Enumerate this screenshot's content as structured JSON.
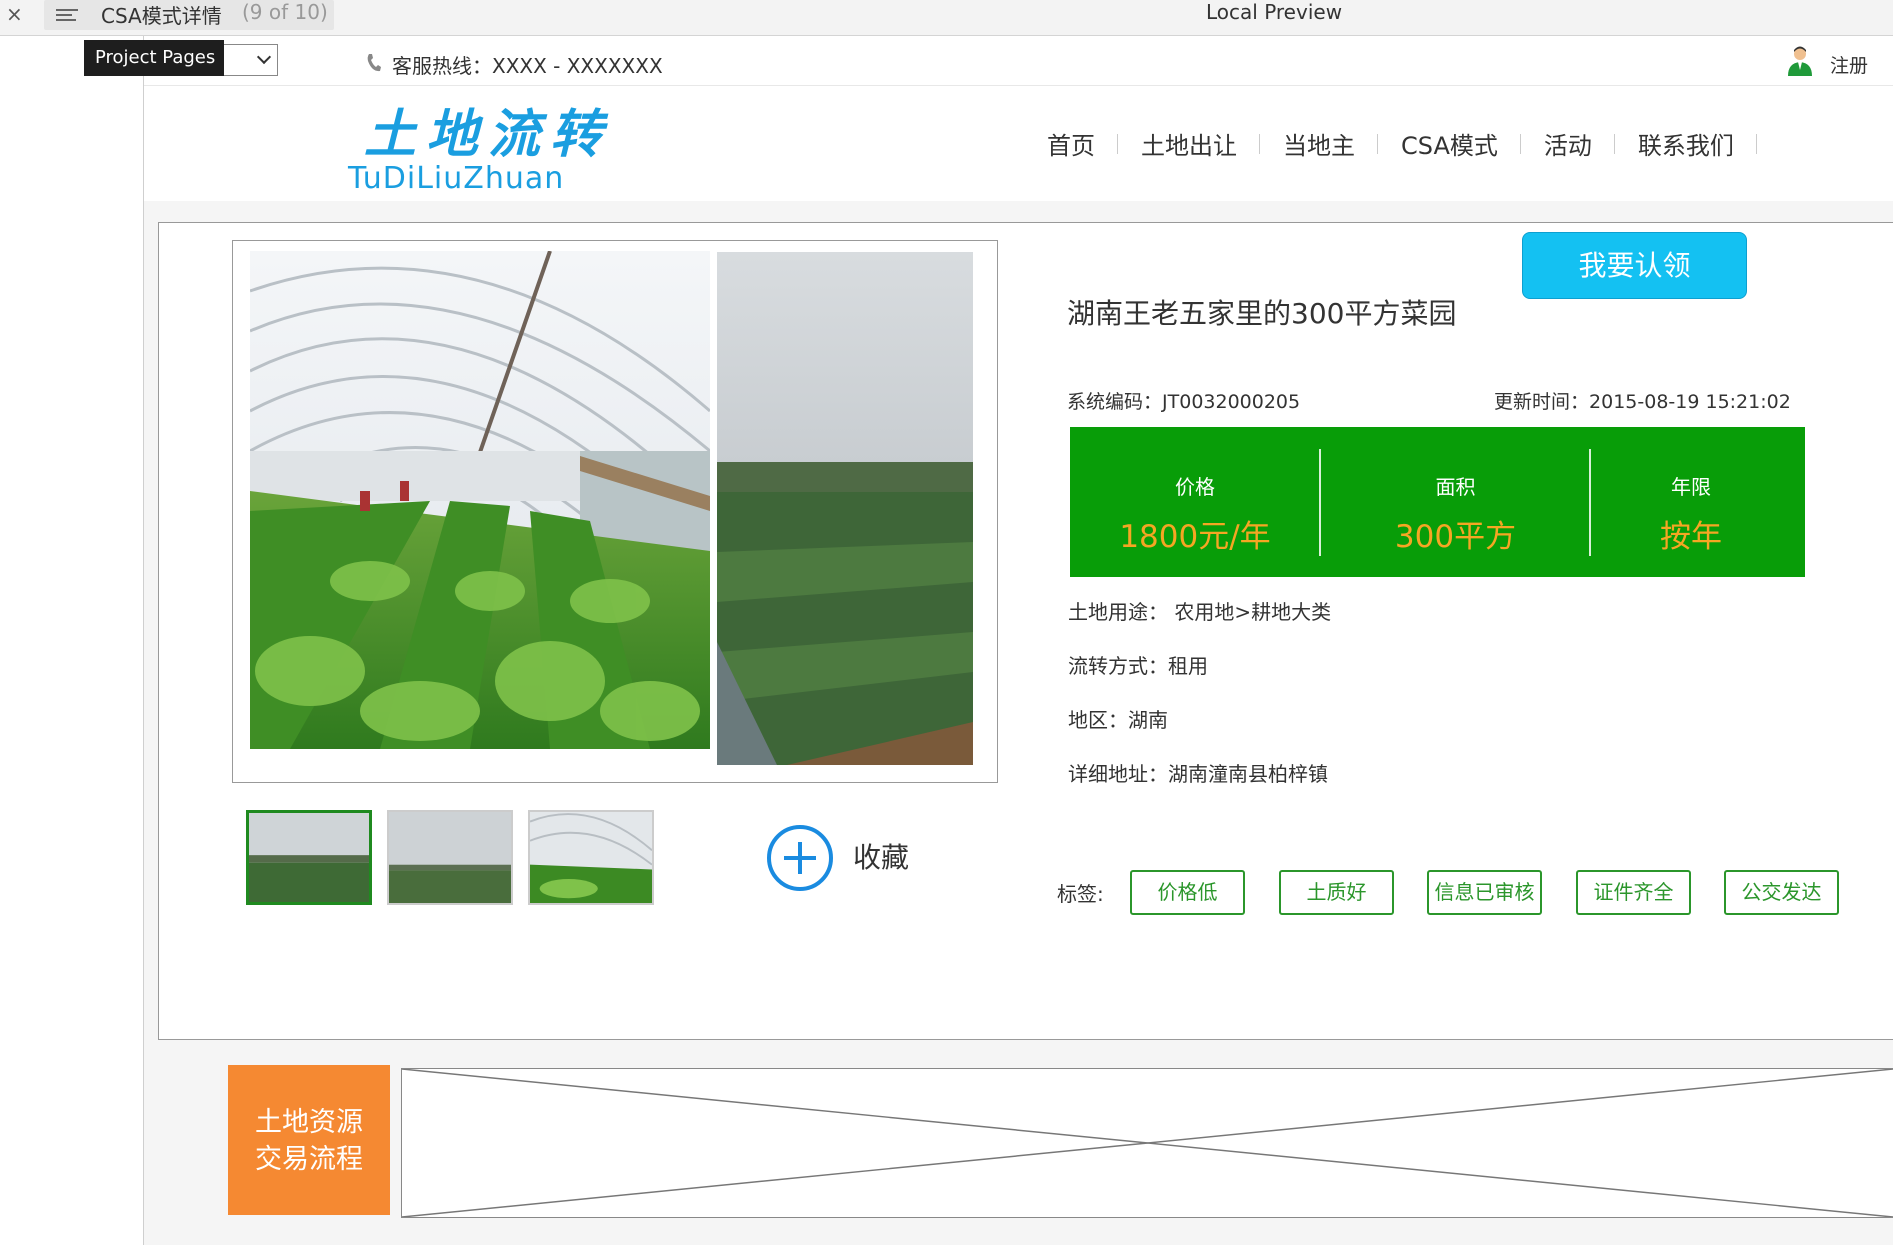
{
  "chrome": {
    "close": "×",
    "page_title": "CSA模式详情",
    "page_count": "(9 of 10)",
    "center_title": "Local Preview",
    "tooltip": "Project Pages"
  },
  "topbar": {
    "select_value": "",
    "hotline": "客服热线：XXXX - XXXXXXX",
    "register": "注册"
  },
  "header": {
    "logo_cn": "土地流转",
    "logo_en": "TuDiLiuZhuan",
    "nav": [
      "首页",
      "土地出让",
      "当地主",
      "CSA模式",
      "活动",
      "联系我们"
    ]
  },
  "detail": {
    "claim_button": "我要认领",
    "title": "湖南王老五家里的300平方菜园",
    "code_label": "系统编码：",
    "code_value": "JT0032000205",
    "updated_label": "更新时间：",
    "updated_value": "2015-08-19 15:21:02",
    "stats": [
      {
        "label": "价格",
        "value": "1800元/年"
      },
      {
        "label": "面积",
        "value": "300平方"
      },
      {
        "label": "年限",
        "value": "按年"
      }
    ],
    "info": [
      {
        "label": "土地用途：",
        "value": "农用地>耕地大类"
      },
      {
        "label": "流转方式：",
        "value": "租用"
      },
      {
        "label": "地区：",
        "value": "湖南"
      },
      {
        "label": "详细地址：",
        "value": "湖南潼南县柏梓镇"
      }
    ],
    "favorite": "收藏",
    "tags_label": "标签:",
    "tags": [
      "价格低",
      "土质好",
      "信息已审核",
      "证件齐全",
      "公交发达"
    ]
  },
  "process": {
    "line1": "土地资源",
    "line2": "交易流程"
  },
  "colors": {
    "brand_blue": "#1a9ee0",
    "claim_button": "#14c1f2",
    "stats_green": "#089d08",
    "stat_value_orange": "#f5a623",
    "tag_green": "#2b962b",
    "process_orange": "#f58932"
  }
}
